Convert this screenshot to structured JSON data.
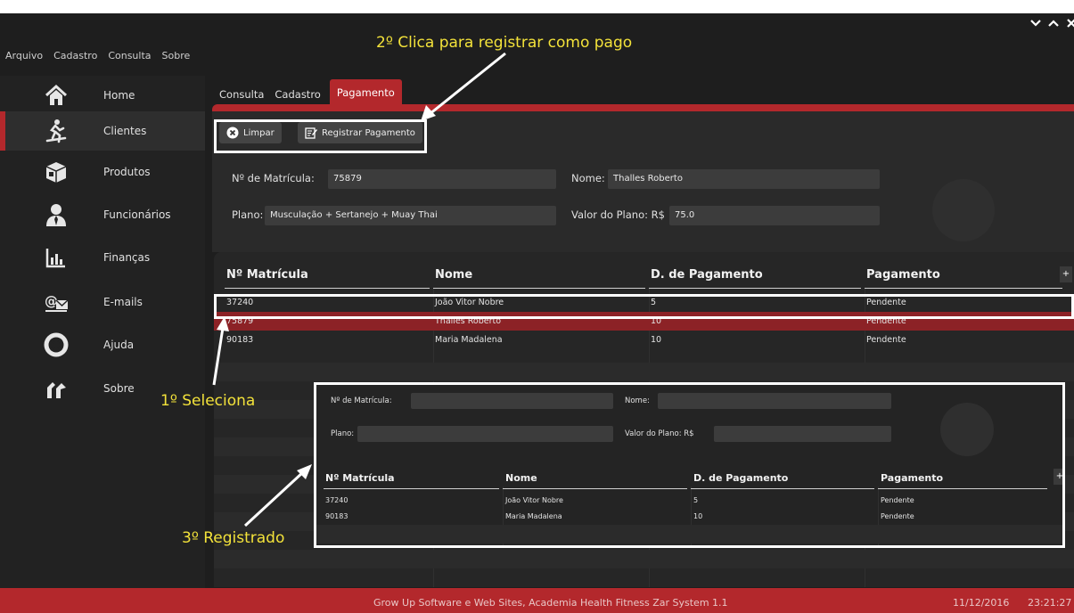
{
  "menubar": [
    "Arquivo",
    "Cadastro",
    "Consulta",
    "Sobre"
  ],
  "sidebar": {
    "items": [
      {
        "label": "Home",
        "icon": "home-icon"
      },
      {
        "label": "Clientes",
        "icon": "runner-icon"
      },
      {
        "label": "Produtos",
        "icon": "box-icon"
      },
      {
        "label": "Funcionários",
        "icon": "employee-icon"
      },
      {
        "label": "Finanças",
        "icon": "bar-chart-icon"
      },
      {
        "label": "E-mails",
        "icon": "email-icon"
      },
      {
        "label": "Ajuda",
        "icon": "lifebuoy-icon"
      },
      {
        "label": "Sobre",
        "icon": "tools-icon"
      }
    ],
    "active": "Clientes"
  },
  "tabs": [
    {
      "label": "Consulta"
    },
    {
      "label": "Cadastro"
    },
    {
      "label": "Pagamento"
    }
  ],
  "toolbar": {
    "clear_label": "Limpar",
    "register_label": "Registrar Pagamento"
  },
  "form": {
    "matricula_label": "Nº de Matrícula:",
    "matricula_value": "75879",
    "nome_label": "Nome:",
    "nome_value": "Thalles Roberto",
    "plano_label": "Plano:",
    "plano_value": "Musculação + Sertanejo + Muay Thai",
    "valor_label": "Valor do Plano: R$",
    "valor_value": "75.0"
  },
  "table": {
    "headers": [
      "Nº Matrícula",
      "Nome",
      "D. de Pagamento",
      "Pagamento"
    ],
    "add_column_label": "+",
    "rows": [
      {
        "matricula": "37240",
        "nome": "João Vitor Nobre",
        "dia": "5",
        "status": "Pendente"
      },
      {
        "matricula": "75879",
        "nome": "Thalles Roberto",
        "dia": "10",
        "status": "Pendente"
      },
      {
        "matricula": "90183",
        "nome": "Maria Madalena",
        "dia": "10",
        "status": "Pendente"
      }
    ]
  },
  "inset": {
    "form": {
      "matricula_label": "Nº de Matrícula:",
      "nome_label": "Nome:",
      "plano_label": "Plano:",
      "valor_label": "Valor do Plano: R$"
    },
    "headers": [
      "Nº Matrícula",
      "Nome",
      "D. de Pagamento",
      "Pagamento"
    ],
    "add_column_label": "+",
    "rows": [
      {
        "matricula": "37240",
        "nome": "João Vitor Nobre",
        "dia": "5",
        "status": "Pendente"
      },
      {
        "matricula": "90183",
        "nome": "Maria Madalena",
        "dia": "10",
        "status": "Pendente"
      }
    ]
  },
  "annotations": {
    "step1": "1º Seleciona",
    "step2": "2º Clica para registrar como pago",
    "step3": "3º Registrado"
  },
  "footer": {
    "text": "Grow Up Software e Web Sites, Academia Health Fitness Zar System 1.1",
    "date": "11/12/2016",
    "time": "23:21:27"
  },
  "colors": {
    "accent": "#b3282c",
    "selected_row": "#8c2226",
    "annotation": "#f3e23a"
  }
}
